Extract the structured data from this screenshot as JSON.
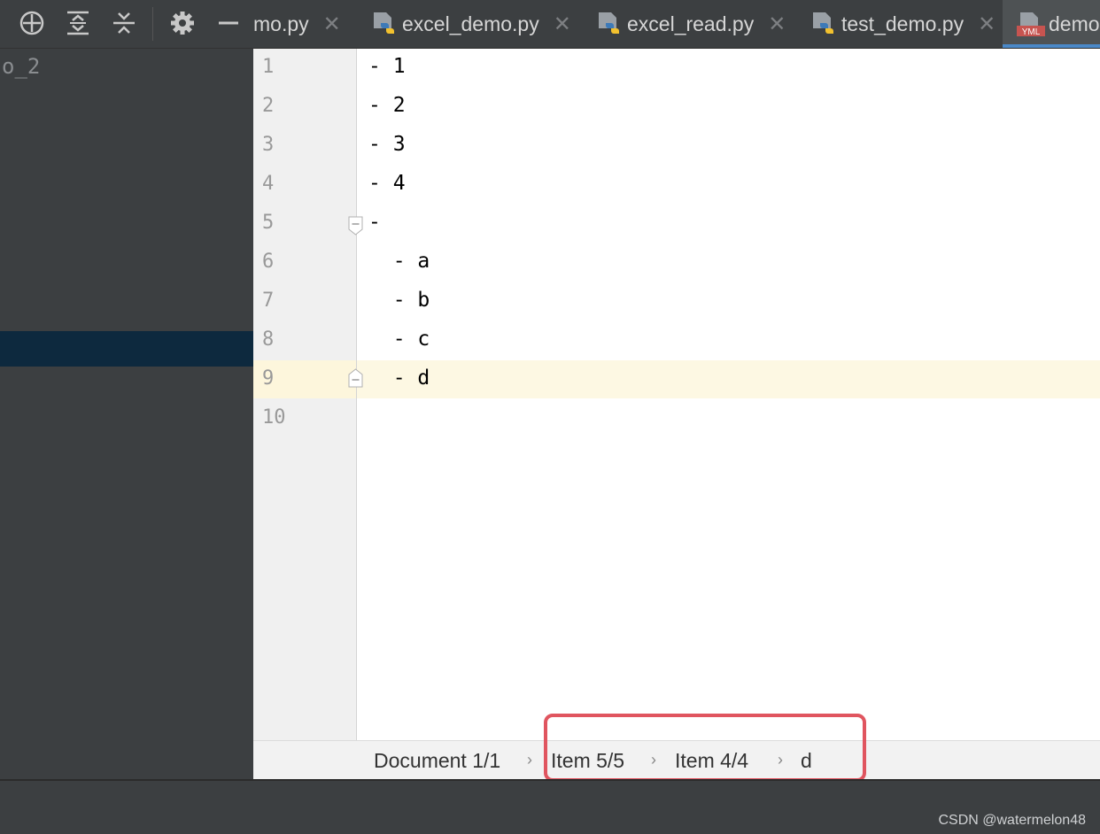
{
  "toolbar": {
    "icons": [
      "locate-icon",
      "expand-all-icon",
      "collapse-all-icon",
      "settings-icon",
      "minimize-icon"
    ]
  },
  "project": {
    "root_label": "o_2"
  },
  "tabs": [
    {
      "label": "mo.py",
      "icon": "python-file-icon",
      "active": false
    },
    {
      "label": "excel_demo.py",
      "icon": "python-file-icon",
      "active": false
    },
    {
      "label": "excel_read.py",
      "icon": "python-file-icon",
      "active": false
    },
    {
      "label": "test_demo.py",
      "icon": "python-file-icon",
      "active": false
    },
    {
      "label": "demo",
      "icon": "yml-file-icon",
      "icon_text": "YML",
      "active": true
    }
  ],
  "tab_close_glyph": "✕",
  "editor": {
    "lines": [
      {
        "num": "1",
        "text": "- 1"
      },
      {
        "num": "2",
        "text": "- 2"
      },
      {
        "num": "3",
        "text": "- 3"
      },
      {
        "num": "4",
        "text": "- 4"
      },
      {
        "num": "5",
        "text": "-"
      },
      {
        "num": "6",
        "text": "  - a"
      },
      {
        "num": "7",
        "text": "  - b"
      },
      {
        "num": "8",
        "text": "  - c"
      },
      {
        "num": "9",
        "text": "  - d"
      },
      {
        "num": "10",
        "text": ""
      }
    ],
    "current_line": "9"
  },
  "breadcrumb": {
    "items": [
      "Document 1/1",
      "Item 5/5",
      "Item 4/4",
      "d"
    ],
    "separator": "›"
  },
  "colors": {
    "highlight_box": "#e0555f",
    "active_tab_underline": "#4a88c7",
    "current_line": "#fdf8e3"
  },
  "watermark": "CSDN @watermelon48"
}
